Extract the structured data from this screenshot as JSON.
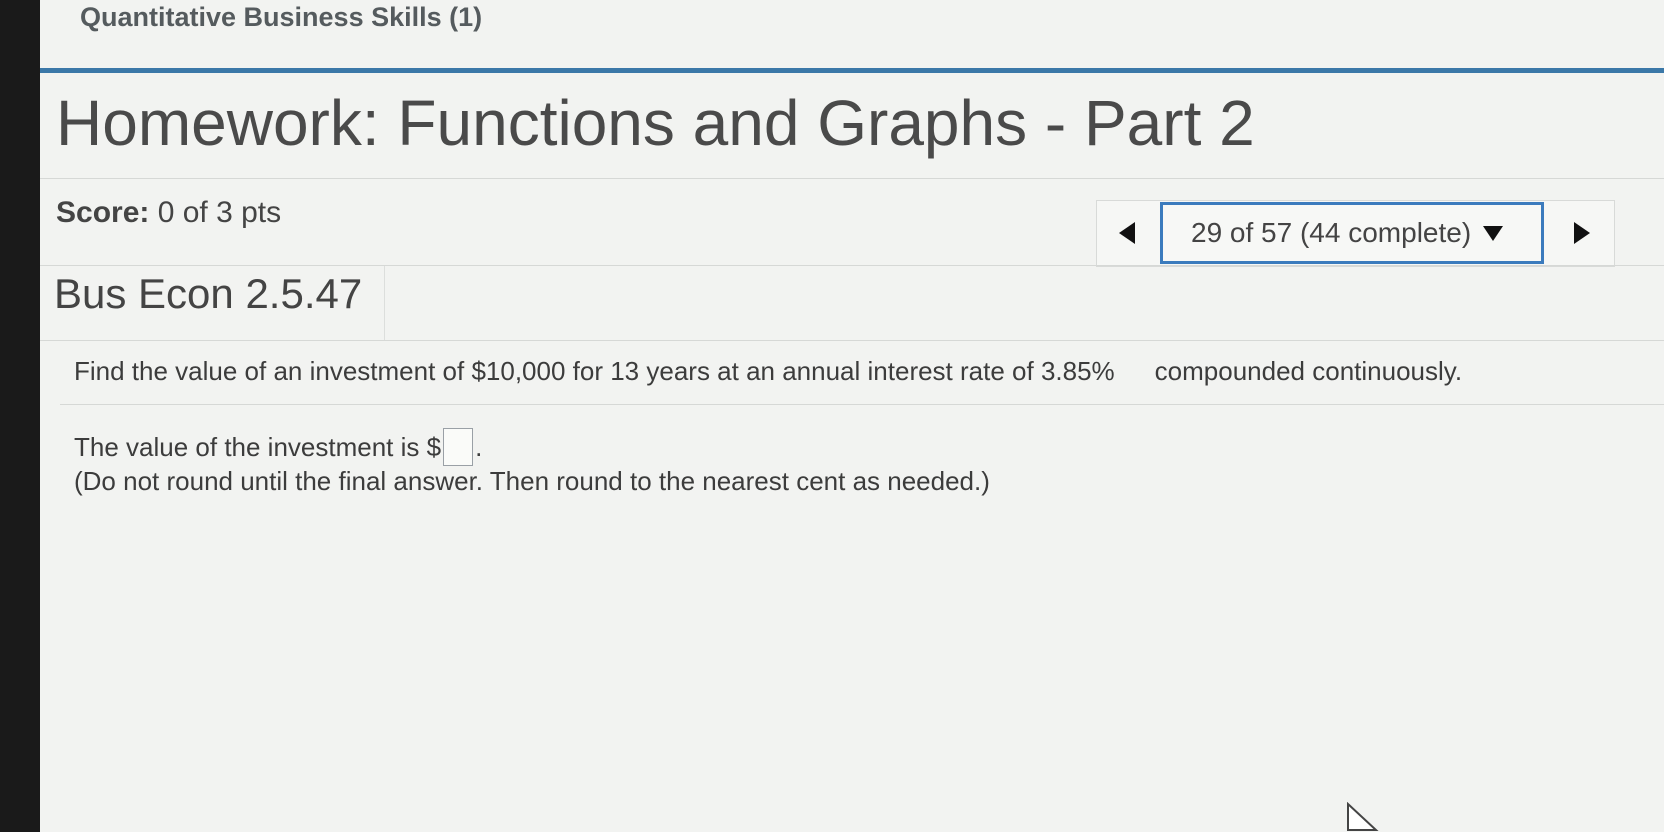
{
  "header": {
    "course_title": "Quantitative Business Skills (1)"
  },
  "assignment": {
    "title": "Homework: Functions and Graphs - Part 2"
  },
  "score": {
    "label": "Score:",
    "value": "0 of 3 pts"
  },
  "navigation": {
    "question_selector": "29 of 57 (44 complete)",
    "prev_icon": "triangle-left",
    "next_icon": "triangle-right",
    "dropdown_icon": "triangle-down"
  },
  "question": {
    "id": "Bus Econ 2.5.47",
    "prompt": "Find the value of an investment of $10,000 for 13 years at an annual interest rate of 3.85%",
    "prompt_cont": "compounded continuously.",
    "answer_prefix": "The value of the investment is $",
    "answer_value": "",
    "answer_suffix": ".",
    "note": "(Do not round until the final answer. Then round to the nearest cent as needed.)"
  },
  "colors": {
    "accent_rule": "#3b78a8",
    "selector_border": "#3b7bbd",
    "background": "#f2f3f1"
  }
}
